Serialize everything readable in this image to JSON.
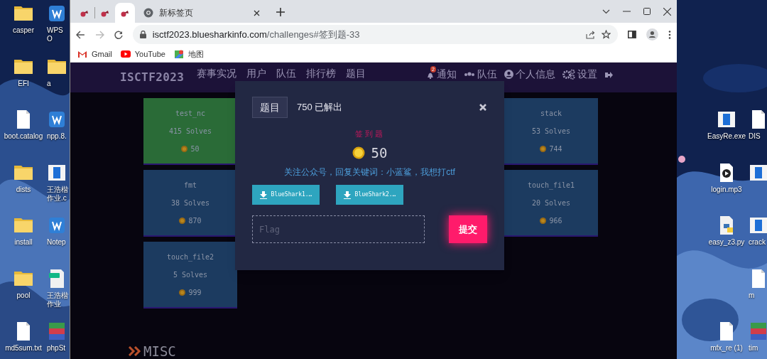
{
  "desktop": {
    "left_columns": [
      [
        {
          "kind": "folder",
          "label": "casper"
        },
        {
          "kind": "folder",
          "label": "EFI"
        },
        {
          "kind": "file",
          "label": "boot.catalog"
        },
        {
          "kind": "folder",
          "label": "dists"
        },
        {
          "kind": "folder",
          "label": "install"
        },
        {
          "kind": "folder",
          "label": "pool"
        },
        {
          "kind": "file",
          "label": "md5sum.txt"
        }
      ],
      [
        {
          "kind": "app",
          "label": "WPS O"
        },
        {
          "kind": "folder",
          "label": "a"
        },
        {
          "kind": "app",
          "label": "npp.8."
        },
        {
          "kind": "doc",
          "label": "王浩楷作业.c"
        },
        {
          "kind": "app",
          "label": "Notep"
        },
        {
          "kind": "pdf",
          "label": "王浩楷作业"
        },
        {
          "kind": "archive",
          "label": "phpSt"
        }
      ]
    ],
    "right_columns": [
      [
        {
          "kind": "empty"
        },
        {
          "kind": "empty"
        },
        {
          "kind": "doc",
          "label": "EasyRe.exe"
        },
        {
          "kind": "media",
          "label": "login.mp3"
        },
        {
          "kind": "python",
          "label": "easy_z3.py"
        },
        {
          "kind": "empty"
        },
        {
          "kind": "file",
          "label": "mfx_re (1)"
        }
      ],
      [
        {
          "kind": "empty"
        },
        {
          "kind": "empty"
        },
        {
          "kind": "file",
          "label": "DIS"
        },
        {
          "kind": "doc"
        },
        {
          "kind": "doc",
          "label": "crack"
        },
        {
          "kind": "file",
          "label": "m"
        },
        {
          "kind": "archive",
          "label": "tim"
        }
      ]
    ]
  },
  "browser": {
    "tabs": [
      {
        "kind": "site",
        "selected": false
      },
      {
        "kind": "site",
        "selected": false
      },
      {
        "kind": "site",
        "selected": true
      },
      {
        "kind": "newtab",
        "title": "新标签页",
        "selected": false
      }
    ],
    "forward_disabled": true,
    "address": {
      "host": "isctf2023.bluesharkinfo.com",
      "path": "/challenges#签到题-33"
    },
    "bookmarks": [
      {
        "kind": "gmail",
        "label": "Gmail"
      },
      {
        "kind": "youtube",
        "label": "YouTube"
      },
      {
        "kind": "maps",
        "label": "地图"
      }
    ]
  },
  "site": {
    "logo": "ISCTF2023",
    "nav_left": [
      "赛事实况",
      "用户",
      "队伍",
      "排行榜",
      "题目"
    ],
    "nav_right": [
      {
        "kind": "bell",
        "label": "通知",
        "badge": "2"
      },
      {
        "kind": "team",
        "label": "队伍"
      },
      {
        "kind": "user",
        "label": "个人信息"
      },
      {
        "kind": "gears",
        "label": "设置"
      },
      {
        "kind": "logout"
      }
    ],
    "challenges": [
      {
        "name": "test_nc",
        "solves": "415 Solves",
        "points": "50",
        "solved": true
      },
      {
        "name": "stack",
        "solves": "53 Solves",
        "points": "744",
        "solved": false
      },
      {
        "name": "fmt",
        "solves": "38 Solves",
        "points": "870",
        "solved": false
      },
      {
        "name": "touch_file1",
        "solves": "20 Solves",
        "points": "966",
        "solved": false
      },
      {
        "name": "touch_file2",
        "solves": "5 Solves",
        "points": "999",
        "solved": false
      }
    ],
    "section": "MISC"
  },
  "modal": {
    "tab": "题目",
    "solves": "750 已解出",
    "title": "签到题",
    "points": "50",
    "description": "关注公众号，回复关键词：小蓝鲨，我想打ctf",
    "files": [
      "BlueShark1.…",
      "BlueShark2.…"
    ],
    "flag_placeholder": "Flag",
    "submit": "提交"
  }
}
